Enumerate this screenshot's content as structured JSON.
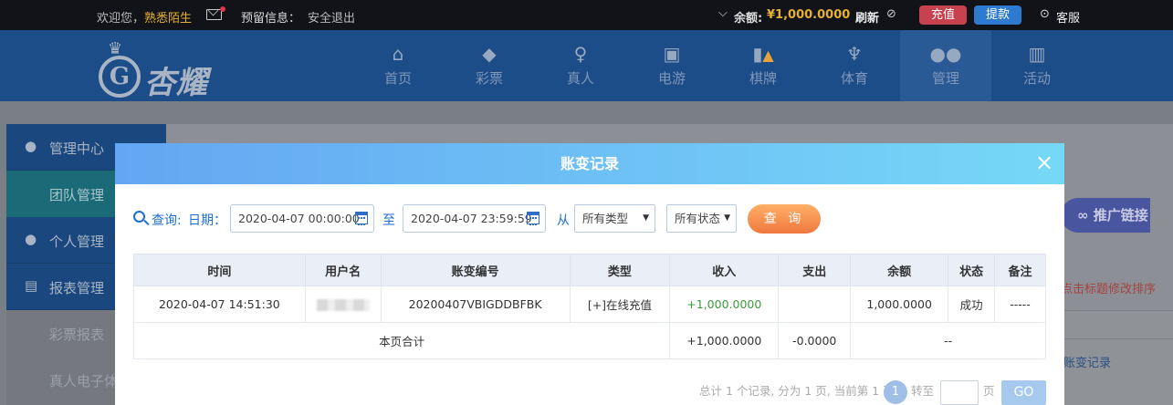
{
  "topbar": {
    "welcome": "欢迎您，",
    "username": "熟悉陌生",
    "reserved_label": "预留信息：",
    "logout": "安全退出",
    "chevron": "⌵",
    "balance_label": "余额:",
    "balance_value": "¥1,000.0000",
    "refresh": "刷新",
    "recharge": "充值",
    "withdraw": "提款",
    "service": "客服",
    "colors": {
      "recharge_bg": "#c8414f",
      "withdraw_bg": "#2f7ad1"
    }
  },
  "brand": {
    "name": "杏耀",
    "mark": "G"
  },
  "nav": [
    {
      "label": "首页",
      "icon": "home-icon"
    },
    {
      "label": "彩票",
      "icon": "lottery-icon"
    },
    {
      "label": "真人",
      "icon": "live-icon"
    },
    {
      "label": "电游",
      "icon": "slot-icon"
    },
    {
      "label": "棋牌",
      "icon": "cards-icon"
    },
    {
      "label": "体育",
      "icon": "trophy-icon"
    },
    {
      "label": "管理",
      "icon": "users-icon"
    },
    {
      "label": "活动",
      "icon": "gift-icon"
    }
  ],
  "sidebar": {
    "items": [
      {
        "label": "管理中心"
      },
      {
        "label": "团队管理"
      },
      {
        "label": "个人管理"
      },
      {
        "label": "报表管理"
      },
      {
        "label": "彩票报表"
      },
      {
        "label": "真人电子体"
      }
    ]
  },
  "page": {
    "promo": "推广链接",
    "hint": "点击标题修改排序",
    "link": "账变记录"
  },
  "modal": {
    "title": "账变记录",
    "close": "×",
    "query_label": "查询:",
    "date_label": "日期：",
    "date_from": "2020-04-07 00:00:00",
    "to_label": "至",
    "date_to": "2020-04-07 23:59:59",
    "from_label": "从",
    "type_select": "所有类型",
    "status_select": "所有状态",
    "query_button": "查 询",
    "table": {
      "columns": [
        "时间",
        "用户名",
        "账变编号",
        "类型",
        "收入",
        "支出",
        "余额",
        "状态",
        "备注"
      ],
      "rows": [
        {
          "time": "2020-04-07 14:51:30",
          "user": "",
          "code": "20200407VBIGDDBFBK",
          "type": "[+]在线充值",
          "income": "+1,000.0000",
          "expense": "",
          "balance": "1,000.0000",
          "status": "成功",
          "note": "-----"
        }
      ],
      "summary": {
        "label": "本页合计",
        "income": "+1,000.0000",
        "expense": "-0.0000",
        "rest": "--"
      }
    },
    "pager": {
      "summary": "总计 1 个记录, 分为 1 页, 当前第 1 页",
      "current": "1",
      "goto": "转至",
      "page_unit": "页",
      "go": "GO"
    }
  }
}
